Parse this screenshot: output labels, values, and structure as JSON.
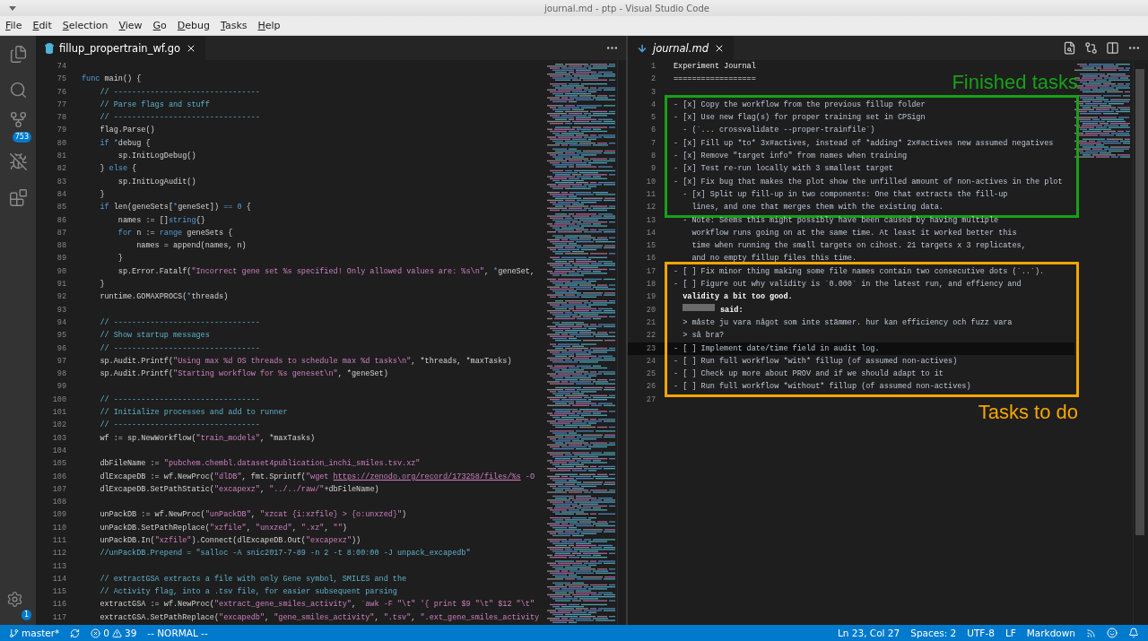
{
  "window": {
    "title": "journal.md - ptp - Visual Studio Code"
  },
  "menu": [
    "File",
    "Edit",
    "Selection",
    "View",
    "Go",
    "Debug",
    "Tasks",
    "Help"
  ],
  "activity_bar": {
    "items": [
      {
        "kind": "explorer",
        "selected": false
      },
      {
        "kind": "search",
        "selected": false
      },
      {
        "kind": "source_control",
        "selected": false,
        "badge": "753"
      },
      {
        "kind": "debug",
        "selected": false
      },
      {
        "kind": "extensions",
        "selected": false
      }
    ],
    "settings_badge": "1"
  },
  "left_editor": {
    "tab": {
      "label": "fillup_propertrain_wf.go",
      "selected": true
    },
    "lines": [
      {
        "number": "74"
      },
      {
        "number": "75",
        "tokens": [
          {
            "kind": "keyword",
            "text": "func"
          },
          {
            "kind": "plain",
            "text": " main() {"
          }
        ]
      },
      {
        "number": "76",
        "tokens": [
          {
            "kind": "comment",
            "text": "    // --------------------------------"
          }
        ]
      },
      {
        "number": "77",
        "tokens": [
          {
            "kind": "comment",
            "text": "    // Parse flags and stuff"
          }
        ]
      },
      {
        "number": "78",
        "tokens": [
          {
            "kind": "comment",
            "text": "    // --------------------------------"
          }
        ]
      },
      {
        "number": "79",
        "tokens": [
          {
            "kind": "plain",
            "text": "    flag.Parse()"
          }
        ]
      },
      {
        "number": "80",
        "tokens": [
          {
            "kind": "keyword",
            "text": "    if *"
          },
          {
            "kind": "plain",
            "text": "debug {"
          }
        ]
      },
      {
        "number": "81",
        "tokens": [
          {
            "kind": "plain",
            "text": "        sp.InitLogDebug()"
          }
        ]
      },
      {
        "number": "82",
        "tokens": [
          {
            "kind": "plain",
            "text": "    } "
          },
          {
            "kind": "keyword",
            "text": "else"
          },
          {
            "kind": "plain",
            "text": " {"
          }
        ]
      },
      {
        "number": "83",
        "tokens": [
          {
            "kind": "plain",
            "text": "        sp.InitLogAudit()"
          }
        ]
      },
      {
        "number": "84",
        "tokens": [
          {
            "kind": "plain",
            "text": "    }"
          }
        ]
      },
      {
        "number": "85",
        "tokens": [
          {
            "kind": "keyword",
            "text": "    if"
          },
          {
            "kind": "plain",
            "text": " len(geneSets["
          },
          {
            "kind": "keyword",
            "text": "*"
          },
          {
            "kind": "plain",
            "text": "geneSet]) "
          },
          {
            "kind": "keyword",
            "text": "== 0"
          },
          {
            "kind": "plain",
            "text": " {"
          }
        ]
      },
      {
        "number": "86",
        "tokens": [
          {
            "kind": "plain",
            "text": "        names := []"
          },
          {
            "kind": "keyword",
            "text": "string"
          },
          {
            "kind": "plain",
            "text": "{}"
          }
        ]
      },
      {
        "number": "87",
        "tokens": [
          {
            "kind": "keyword",
            "text": "        for"
          },
          {
            "kind": "plain",
            "text": " n := "
          },
          {
            "kind": "keyword",
            "text": "range"
          },
          {
            "kind": "plain",
            "text": " geneSets {"
          }
        ]
      },
      {
        "number": "88",
        "tokens": [
          {
            "kind": "plain",
            "text": "            names = append(names, n)"
          }
        ]
      },
      {
        "number": "89",
        "tokens": [
          {
            "kind": "plain",
            "text": "        }"
          }
        ]
      },
      {
        "number": "90",
        "tokens": [
          {
            "kind": "plain",
            "text": "        sp.Error.Fatalf("
          },
          {
            "kind": "string",
            "text": "\"Incorrect gene set %s specified! Only allowed values are: %s\\n\""
          },
          {
            "kind": "plain",
            "text": ", "
          },
          {
            "kind": "keyword",
            "text": "*"
          },
          {
            "kind": "plain",
            "text": "geneSet,"
          }
        ]
      },
      {
        "number": "91",
        "tokens": [
          {
            "kind": "plain",
            "text": "    }"
          }
        ]
      },
      {
        "number": "92",
        "tokens": [
          {
            "kind": "plain",
            "text": "    runtime.GOMAXPROCS("
          },
          {
            "kind": "keyword",
            "text": "*"
          },
          {
            "kind": "plain",
            "text": "threads)"
          }
        ]
      },
      {
        "number": "93"
      },
      {
        "number": "94",
        "tokens": [
          {
            "kind": "comment",
            "text": "    // --------------------------------"
          }
        ]
      },
      {
        "number": "95",
        "tokens": [
          {
            "kind": "comment",
            "text": "    // Show startup messages"
          }
        ]
      },
      {
        "number": "96",
        "tokens": [
          {
            "kind": "comment",
            "text": "    // --------------------------------"
          }
        ]
      },
      {
        "number": "97",
        "tokens": [
          {
            "kind": "plain",
            "text": "    sp.Audit.Printf("
          },
          {
            "kind": "string",
            "text": "\"Using max %d OS threads to schedule max %d tasks\\n\""
          },
          {
            "kind": "plain",
            "text": ", *threads, *maxTasks)"
          }
        ]
      },
      {
        "number": "98",
        "tokens": [
          {
            "kind": "plain",
            "text": "    sp.Audit.Printf("
          },
          {
            "kind": "string",
            "text": "\"Starting workflow for %s geneset\\n\""
          },
          {
            "kind": "plain",
            "text": ", *geneSet)"
          }
        ]
      },
      {
        "number": "99"
      },
      {
        "number": "100",
        "tokens": [
          {
            "kind": "comment",
            "text": "    // --------------------------------"
          }
        ]
      },
      {
        "number": "101",
        "tokens": [
          {
            "kind": "comment",
            "text": "    // Initialize processes and add to runner"
          }
        ]
      },
      {
        "number": "102",
        "tokens": [
          {
            "kind": "comment",
            "text": "    // --------------------------------"
          }
        ]
      },
      {
        "number": "103",
        "tokens": [
          {
            "kind": "plain",
            "text": "    wf := sp.NewWorkflow("
          },
          {
            "kind": "string",
            "text": "\"train_models\""
          },
          {
            "kind": "plain",
            "text": ", *maxTasks)"
          }
        ]
      },
      {
        "number": "104"
      },
      {
        "number": "105",
        "tokens": [
          {
            "kind": "plain",
            "text": "    dbFileName := "
          },
          {
            "kind": "string",
            "text": "\"pubchem.chembl.dataset4publication_inchi_smiles.tsv.xz\""
          }
        ]
      },
      {
        "number": "106",
        "tokens": [
          {
            "kind": "plain",
            "text": "    dlExcapeDB := wf.NewProc("
          },
          {
            "kind": "string",
            "text": "\"dlDB\""
          },
          {
            "kind": "plain",
            "text": ", fmt.Sprintf("
          },
          {
            "kind": "string",
            "text": "\"wget "
          },
          {
            "kind": "link",
            "text": "https://zenodo.org/record/173258/files/%s"
          },
          {
            "kind": "string",
            "text": " -O"
          }
        ]
      },
      {
        "number": "107",
        "tokens": [
          {
            "kind": "plain",
            "text": "    dlExcapeDB.SetPathStatic("
          },
          {
            "kind": "string",
            "text": "\"excapexz\""
          },
          {
            "kind": "plain",
            "text": ", "
          },
          {
            "kind": "string",
            "text": "\"../../raw/\""
          },
          {
            "kind": "plain",
            "text": "+dbFileName)"
          }
        ]
      },
      {
        "number": "108"
      },
      {
        "number": "109",
        "tokens": [
          {
            "kind": "plain",
            "text": "    unPackDB := wf.NewProc("
          },
          {
            "kind": "string",
            "text": "\"unPackDB\""
          },
          {
            "kind": "plain",
            "text": ", "
          },
          {
            "kind": "string",
            "text": "\"xzcat {i:xzfile} > {o:unxzed}\""
          },
          {
            "kind": "plain",
            "text": ")"
          }
        ]
      },
      {
        "number": "110",
        "tokens": [
          {
            "kind": "plain",
            "text": "    unPackDB.SetPathReplace("
          },
          {
            "kind": "string",
            "text": "\"xzfile\""
          },
          {
            "kind": "plain",
            "text": ", "
          },
          {
            "kind": "string",
            "text": "\"unxzed\""
          },
          {
            "kind": "plain",
            "text": ", "
          },
          {
            "kind": "string",
            "text": "\".xz\""
          },
          {
            "kind": "plain",
            "text": ", "
          },
          {
            "kind": "string",
            "text": "\"\""
          },
          {
            "kind": "plain",
            "text": ")"
          }
        ]
      },
      {
        "number": "111",
        "tokens": [
          {
            "kind": "plain",
            "text": "    unPackDB.In("
          },
          {
            "kind": "string",
            "text": "\"xzfile\""
          },
          {
            "kind": "plain",
            "text": ").Connect(dlExcapeDB.Out("
          },
          {
            "kind": "string",
            "text": "\"excapexz\""
          },
          {
            "kind": "plain",
            "text": "))"
          }
        ]
      },
      {
        "number": "112",
        "tokens": [
          {
            "kind": "comment",
            "text": "    //unPackDB.Prepend = \"salloc -A snic2017-7-89 -n 2 -t 8:00:00 -J unpack_excapedb\""
          }
        ]
      },
      {
        "number": "113"
      },
      {
        "number": "114",
        "tokens": [
          {
            "kind": "comment",
            "text": "    // extractGSA extracts a file with only Gene symbol, SMILES and the"
          }
        ]
      },
      {
        "number": "115",
        "tokens": [
          {
            "kind": "comment",
            "text": "    // Activity flag, into a .tsv file, for easier subsequent parsing"
          }
        ]
      },
      {
        "number": "116",
        "tokens": [
          {
            "kind": "plain",
            "text": "    extractGSA := wf.NewProc("
          },
          {
            "kind": "string",
            "text": "\"extract_gene_smiles_activity\""
          },
          {
            "kind": "plain",
            "text": ", "
          },
          {
            "kind": "string",
            "text": "`awk -F \"\\t\" '{ print $9 \"\\t\" $12 \"\\t\""
          }
        ]
      },
      {
        "number": "117",
        "tokens": [
          {
            "kind": "plain",
            "text": "    extractGSA.SetPathReplace("
          },
          {
            "kind": "string",
            "text": "\"excapedb\""
          },
          {
            "kind": "plain",
            "text": ", "
          },
          {
            "kind": "string",
            "text": "\"gene_smiles_activity\""
          },
          {
            "kind": "plain",
            "text": ", "
          },
          {
            "kind": "string",
            "text": "\".tsv\""
          },
          {
            "kind": "plain",
            "text": ", "
          },
          {
            "kind": "string",
            "text": "\".ext_gene_smiles_activity"
          }
        ]
      }
    ]
  },
  "right_editor": {
    "tab": {
      "label": "journal.md",
      "selected": true
    },
    "blocks": [
      {
        "kind": "plain",
        "lines": [
          {
            "number": "1",
            "kind": "heading",
            "text": "Experiment Journal",
            "current": false
          },
          {
            "number": "2",
            "kind": "heading",
            "text": "==================",
            "current": false
          },
          {
            "number": "3",
            "current": false
          }
        ]
      },
      {
        "kind": "label_above",
        "label": "Finished tasks",
        "color": "#18a018",
        "lines": [
          {
            "number": "4",
            "kind": "item",
            "text": "- [x] Copy the workflow from the previous fillup folder",
            "current": false
          },
          {
            "number": "5",
            "kind": "item",
            "text": "- [x] Use new flag(s) for proper training set in CPSign",
            "current": false
          },
          {
            "number": "6",
            "kind": "item",
            "text": "  - (`... crossvalidate --proper-trainfile`)",
            "current": false
          },
          {
            "number": "7",
            "kind": "item",
            "text": "- [x] Fill up *to* 3x#actives, instead of *adding* 2x#actives new assumed negatives",
            "current": false
          },
          {
            "number": "8",
            "kind": "item",
            "text": "- [x] Remove \"target info\" from names when training",
            "current": false
          },
          {
            "number": "9",
            "kind": "item",
            "text": "- [x] Test re-run locally with 3 smallest target",
            "current": false
          },
          {
            "number": "10",
            "kind": "item",
            "text": "- [x] Fix bug that makes the plot show the unfilled amount of non-actives in the plot",
            "current": false
          },
          {
            "number": "11",
            "kind": "item",
            "text": "  - [x] Split up fill-up in two components: One that extracts the fill-up",
            "current": false
          },
          {
            "number": "12",
            "kind": "item",
            "text": "    lines, and one that merges them with the existing data.",
            "current": false
          }
        ]
      },
      {
        "kind": "plain",
        "lines": [
          {
            "number": "13",
            "kind": "item",
            "text": "  - Note: Seems this might possibly have been caused by having multiple",
            "current": false
          },
          {
            "number": "14",
            "kind": "item",
            "text": "    workflow runs going on at the same time. At least it worked better this",
            "current": false
          },
          {
            "number": "15",
            "kind": "item",
            "text": "    time when running the small targets on cihost. 21 targets x 3 replicates,",
            "current": false
          },
          {
            "number": "16",
            "kind": "item",
            "text": "    and no empty fillup files this time.",
            "current": false
          }
        ]
      },
      {
        "kind": "label_below",
        "label": "Tasks to do",
        "color": "#f5a500",
        "lines": [
          {
            "number": "17",
            "kind": "item",
            "text": "- [ ] Fix minor thing making some file names contain two consecutive dots (`..`).",
            "current": false
          },
          {
            "number": "18",
            "kind": "item",
            "text": "- [ ] Figure out why validity is `0.000` in the latest run, and effiency and",
            "current": false
          },
          {
            "number": "19",
            "kind": "bold",
            "text": "  validity a bit too good.",
            "current": false
          },
          {
            "number": "20",
            "kind": "author",
            "text": "said:",
            "current": false
          },
          {
            "number": "21",
            "kind": "item",
            "text": "  > måste ju vara något som inte stämmer. hur kan efficiency och fuzz vara",
            "current": false
          },
          {
            "number": "22",
            "kind": "item",
            "text": "  > så bra?",
            "current": false
          },
          {
            "number": "23",
            "kind": "item",
            "text": "- [ ] Implement date/time field in audit log.",
            "current": true
          },
          {
            "number": "24",
            "kind": "item",
            "text": "- [ ] Run full workflow *with* fillup (of assumed non-actives)",
            "current": false
          },
          {
            "number": "25",
            "kind": "item",
            "text": "- [ ] Check up more about PROV and if we should adapt to it",
            "current": false
          },
          {
            "number": "26",
            "kind": "item",
            "text": "- [ ] Run full workflow *without* fillup (of assumed non-actives)",
            "current": false
          }
        ]
      },
      {
        "kind": "plain",
        "lines": [
          {
            "number": "27",
            "current": false
          }
        ]
      }
    ]
  },
  "status_bar": {
    "branch": "master*",
    "errors": "0",
    "warnings": "39",
    "mode": "-- NORMAL --",
    "position": "Ln 23, Col 27",
    "indentation": "Spaces: 2",
    "encoding": "UTF-8",
    "line_ending": "LF",
    "language": "Markdown"
  }
}
